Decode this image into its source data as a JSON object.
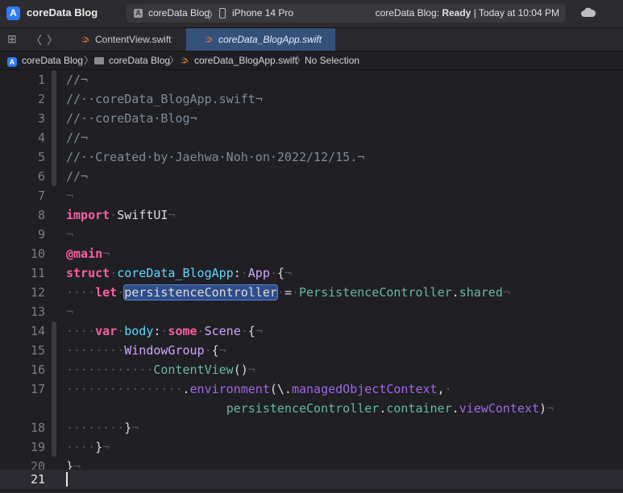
{
  "window": {
    "app_title": "coreData Blog"
  },
  "toolbar": {
    "scheme_target": "coreData Blog",
    "device": "iPhone 14 Pro",
    "status_prefix": "coreData Blog: ",
    "status_state": "Ready",
    "status_suffix": " | Today at 10:04 PM"
  },
  "tabs": [
    {
      "label": "ContentView.swift",
      "active": false
    },
    {
      "label": "coreData_BlogApp.swift",
      "active": true
    }
  ],
  "breadcrumb": {
    "project": "coreData Blog",
    "group": "coreData Blog",
    "file": "coreData_BlogApp.swift",
    "selection": "No Selection"
  },
  "editor": {
    "current_line": 21,
    "line_numbers": [
      "1",
      "2",
      "3",
      "4",
      "5",
      "6",
      "7",
      "8",
      "9",
      "10",
      "11",
      "12",
      "13",
      "14",
      "15",
      "16",
      "17",
      "18",
      "19",
      "20",
      "21"
    ]
  },
  "colors": {
    "comment": "#7f8c98",
    "keyword": "#fc5fa3",
    "type": "#d0a8ff",
    "declaration": "#5dd8ff",
    "project_symbol": "#67b7a4",
    "member": "#a167e6",
    "selection": "#2f4d8a",
    "active_tab": "#34517a"
  }
}
